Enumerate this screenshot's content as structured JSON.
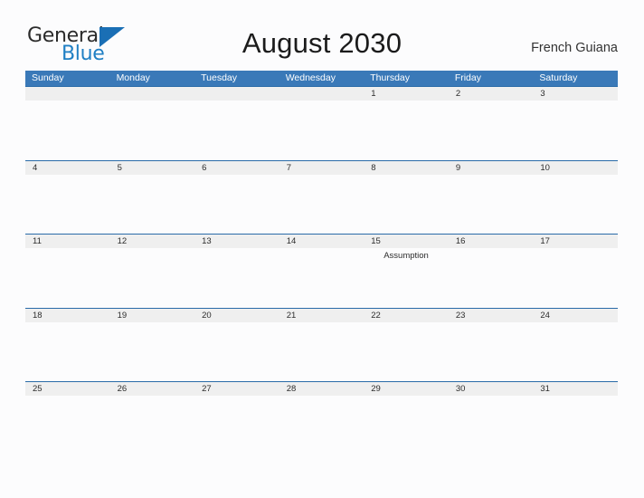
{
  "brand": {
    "name_part1": "General",
    "name_part2": "Blue",
    "color_dark": "#2b2b2b",
    "color_blue": "#1f7fc4",
    "triangle_color": "#1a6fb5"
  },
  "header": {
    "title": "August 2030",
    "region": "French Guiana"
  },
  "colors": {
    "header_blue": "#3a79b8",
    "row_divider_blue": "#2a6ba8",
    "date_band_gray": "#efefef",
    "page_background": "#fcfcfd",
    "text": "#2c2c2c"
  },
  "weekdays": [
    "Sunday",
    "Monday",
    "Tuesday",
    "Wednesday",
    "Thursday",
    "Friday",
    "Saturday"
  ],
  "weeks": [
    {
      "days": [
        {
          "date": "",
          "event": ""
        },
        {
          "date": "",
          "event": ""
        },
        {
          "date": "",
          "event": ""
        },
        {
          "date": "",
          "event": ""
        },
        {
          "date": "1",
          "event": ""
        },
        {
          "date": "2",
          "event": ""
        },
        {
          "date": "3",
          "event": ""
        }
      ]
    },
    {
      "days": [
        {
          "date": "4",
          "event": ""
        },
        {
          "date": "5",
          "event": ""
        },
        {
          "date": "6",
          "event": ""
        },
        {
          "date": "7",
          "event": ""
        },
        {
          "date": "8",
          "event": ""
        },
        {
          "date": "9",
          "event": ""
        },
        {
          "date": "10",
          "event": ""
        }
      ]
    },
    {
      "days": [
        {
          "date": "11",
          "event": ""
        },
        {
          "date": "12",
          "event": ""
        },
        {
          "date": "13",
          "event": ""
        },
        {
          "date": "14",
          "event": ""
        },
        {
          "date": "15",
          "event": "Assumption"
        },
        {
          "date": "16",
          "event": ""
        },
        {
          "date": "17",
          "event": ""
        }
      ]
    },
    {
      "days": [
        {
          "date": "18",
          "event": ""
        },
        {
          "date": "19",
          "event": ""
        },
        {
          "date": "20",
          "event": ""
        },
        {
          "date": "21",
          "event": ""
        },
        {
          "date": "22",
          "event": ""
        },
        {
          "date": "23",
          "event": ""
        },
        {
          "date": "24",
          "event": ""
        }
      ]
    },
    {
      "days": [
        {
          "date": "25",
          "event": ""
        },
        {
          "date": "26",
          "event": ""
        },
        {
          "date": "27",
          "event": ""
        },
        {
          "date": "28",
          "event": ""
        },
        {
          "date": "29",
          "event": ""
        },
        {
          "date": "30",
          "event": ""
        },
        {
          "date": "31",
          "event": ""
        }
      ]
    }
  ]
}
